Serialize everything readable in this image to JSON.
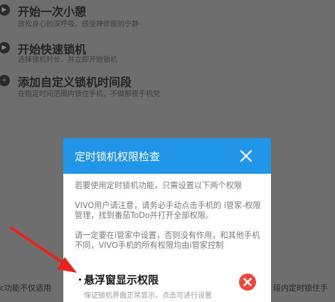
{
  "background": {
    "items": [
      {
        "title": "开始一次小憩",
        "subtitle": "放松身心的深呼吸，感受禅修般的宁静",
        "icon": "play-icon"
      },
      {
        "title": "开始快速锁机",
        "subtitle": "选择锁机时长，并立即开始锁机",
        "icon": "play-icon"
      },
      {
        "title": "添加自定义锁机时间段",
        "subtitle": "在指定时间范围内锁住手机，不做那夜手机党",
        "icon": "plus-icon"
      }
    ],
    "bottom_left_text": "c功能不仅适用",
    "bottom_right_text": "段内定时锁住手"
  },
  "dialog": {
    "title": "定时锁机权限检查",
    "paragraphs": [
      "若要使用定时锁机功能，只需设置以下两个权限",
      "VIVO用户请注意，请务必手动点击手机的 i管家-权限管理，找到番茄ToDo并打开全部权限。",
      "请一定要在i管家中设置，否则没有作用，和其他手机不同，VIVO手机的所有权限均由i管家控制"
    ],
    "permission": {
      "title": "悬浮窗显示权限",
      "subtitle": "保证锁机界面正常显示，点击可进行设置",
      "status": "not-granted"
    }
  },
  "colors": {
    "overlay": "#6e6e6e",
    "header": "#2196e8",
    "status_error": "#f0473d",
    "arrow": "#e8231c"
  }
}
